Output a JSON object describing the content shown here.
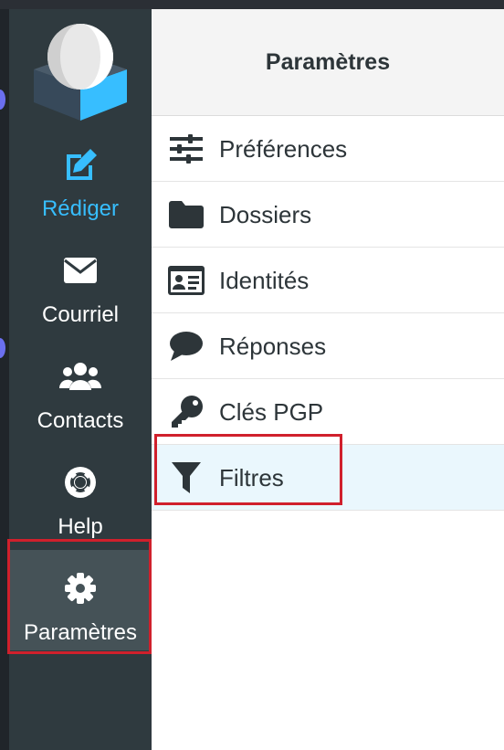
{
  "colors": {
    "sidebar_bg": "#2f3a3f",
    "sidebar_selected_bg": "#455257",
    "accent": "#37beff",
    "highlight_border": "#d0202c",
    "list_selected_bg": "#eaf7fd",
    "text_dark": "#2d3539"
  },
  "logo": {
    "icon": "roundcube-logo-icon"
  },
  "nav": {
    "compose": {
      "label": "Rédiger",
      "icon": "compose-edit-icon"
    },
    "mail": {
      "label": "Courriel",
      "icon": "envelope-icon"
    },
    "contacts": {
      "label": "Contacts",
      "icon": "users-icon"
    },
    "help": {
      "label": "Help",
      "icon": "lifebuoy-icon"
    },
    "settings": {
      "label": "Paramètres",
      "icon": "gear-icon",
      "selected": true
    }
  },
  "header": {
    "title": "Paramètres"
  },
  "settings_list": {
    "preferences": {
      "label": "Préférences",
      "icon": "sliders-icon"
    },
    "folders": {
      "label": "Dossiers",
      "icon": "folder-icon"
    },
    "identities": {
      "label": "Identités",
      "icon": "id-card-icon"
    },
    "responses": {
      "label": "Réponses",
      "icon": "comment-icon"
    },
    "pgp_keys": {
      "label": "Clés PGP",
      "icon": "key-icon"
    },
    "filters": {
      "label": "Filtres",
      "icon": "filter-icon",
      "selected": true
    }
  }
}
